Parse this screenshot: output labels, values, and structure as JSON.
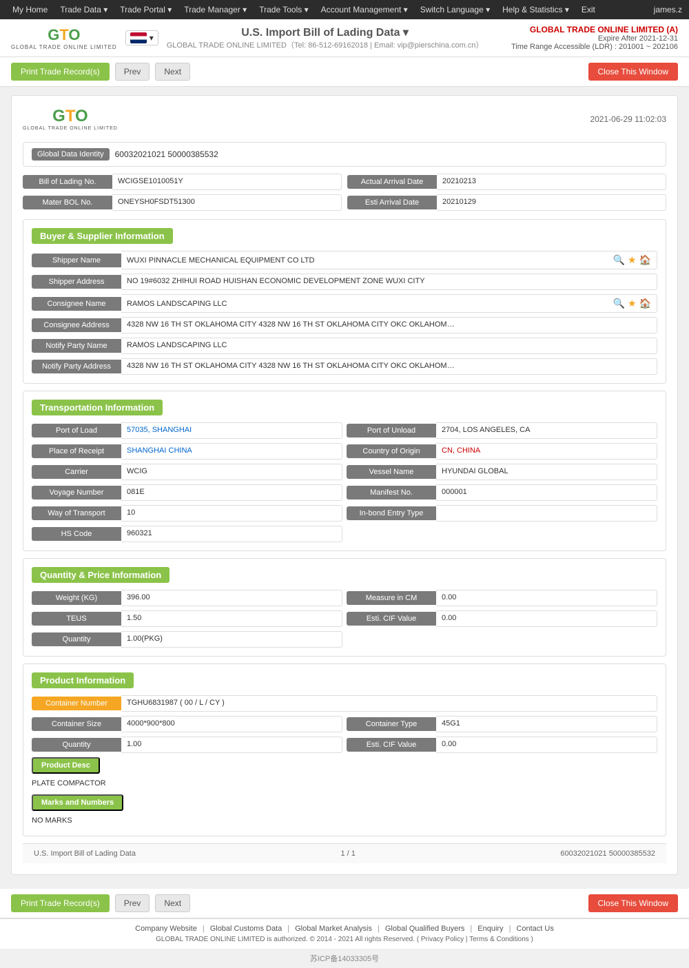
{
  "topnav": {
    "items": [
      "My Home",
      "Trade Data",
      "Trade Portal",
      "Trade Manager",
      "Trade Tools",
      "Account Management",
      "Switch Language",
      "Help & Statistics",
      "Exit"
    ],
    "user": "james.z"
  },
  "header": {
    "logo_g": "G",
    "logo_t": "T",
    "logo_o": "O",
    "logo_sub": "GLOBAL TRADE ONLINE LIMITED",
    "flag_alt": "US Flag",
    "title": "U.S. Import Bill of Lading Data",
    "title_arrow": "▾",
    "company": "GLOBAL TRADE ONLINE LIMITED（Tel: 86-512-69162018 | Email: vip@pierschina.com.cn）",
    "company_link": "GLOBAL TRADE ONLINE LIMITED (A)",
    "expire": "Expire After 2021-12-31",
    "range": "Time Range Accessible (LDR) : 201001 ~ 202106"
  },
  "toolbar": {
    "print_label": "Print Trade Record(s)",
    "prev_label": "Prev",
    "next_label": "Next",
    "close_label": "Close This Window"
  },
  "record": {
    "date": "2021-06-29 11:02:03",
    "global_data_identity": {
      "label": "Global Data Identity",
      "value": "60032021021 50000385532"
    },
    "bill_of_lading": {
      "label": "Bill of Lading No.",
      "value": "WCIGSE1010051Y",
      "actual_arrival_label": "Actual Arrival Date",
      "actual_arrival_value": "20210213"
    },
    "mater_bol": {
      "label": "Mater BOL No.",
      "value": "ONEYSH0FSDT51300",
      "esti_arrival_label": "Esti Arrival Date",
      "esti_arrival_value": "20210129"
    },
    "buyer_supplier": {
      "section_title": "Buyer & Supplier Information",
      "shipper_name_label": "Shipper Name",
      "shipper_name_value": "WUXI PINNACLE MECHANICAL EQUIPMENT CO LTD",
      "shipper_address_label": "Shipper Address",
      "shipper_address_value": "NO 19#6032 ZHIHUI ROAD HUISHAN ECONOMIC DEVELOPMENT ZONE WUXI CITY",
      "consignee_name_label": "Consignee Name",
      "consignee_name_value": "RAMOS LANDSCAPING LLC",
      "consignee_address_label": "Consignee Address",
      "consignee_address_value": "4328 NW 16 TH ST OKLAHOMA CITY 4328 NW 16 TH ST OKLAHOMA CITY OKC OKLAHOM…",
      "notify_party_name_label": "Notify Party Name",
      "notify_party_name_value": "RAMOS LANDSCAPING LLC",
      "notify_party_address_label": "Notify Party Address",
      "notify_party_address_value": "4328 NW 16 TH ST OKLAHOMA CITY 4328 NW 16 TH ST OKLAHOMA CITY OKC OKLAHOM…"
    },
    "transportation": {
      "section_title": "Transportation Information",
      "port_of_load_label": "Port of Load",
      "port_of_load_value": "57035, SHANGHAI",
      "port_of_unload_label": "Port of Unload",
      "port_of_unload_value": "2704, LOS ANGELES, CA",
      "place_of_receipt_label": "Place of Receipt",
      "place_of_receipt_value": "SHANGHAI CHINA",
      "country_of_origin_label": "Country of Origin",
      "country_of_origin_value": "CN, CHINA",
      "carrier_label": "Carrier",
      "carrier_value": "WCIG",
      "vessel_name_label": "Vessel Name",
      "vessel_name_value": "HYUNDAI GLOBAL",
      "voyage_number_label": "Voyage Number",
      "voyage_number_value": "081E",
      "manifest_no_label": "Manifest No.",
      "manifest_no_value": "000001",
      "way_of_transport_label": "Way of Transport",
      "way_of_transport_value": "10",
      "in_bond_entry_label": "In-bond Entry Type",
      "in_bond_entry_value": "",
      "hs_code_label": "HS Code",
      "hs_code_value": "960321"
    },
    "quantity_price": {
      "section_title": "Quantity & Price Information",
      "weight_label": "Weight (KG)",
      "weight_value": "396.00",
      "measure_label": "Measure in CM",
      "measure_value": "0.00",
      "teus_label": "TEUS",
      "teus_value": "1.50",
      "esti_cif_label": "Esti. CIF Value",
      "esti_cif_value": "0.00",
      "quantity_label": "Quantity",
      "quantity_value": "1.00(PKG)"
    },
    "product": {
      "section_title": "Product Information",
      "container_number_label": "Container Number",
      "container_number_value": "TGHU6831987 ( 00 / L / CY )",
      "container_size_label": "Container Size",
      "container_size_value": "4000*900*800",
      "container_type_label": "Container Type",
      "container_type_value": "45G1",
      "quantity_label": "Quantity",
      "quantity_value": "1.00",
      "esti_cif_label": "Esti. CIF Value",
      "esti_cif_value": "0.00",
      "product_desc_label": "Product Desc",
      "product_desc_value": "PLATE COMPACTOR",
      "marks_label": "Marks and Numbers",
      "marks_value": "NO MARKS"
    },
    "footer": {
      "left": "U.S. Import Bill of Lading Data",
      "page": "1 / 1",
      "id": "60032021021 50000385532"
    }
  },
  "bottom_toolbar": {
    "print_label": "Print Trade Record(s)",
    "prev_label": "Prev",
    "next_label": "Next",
    "close_label": "Close This Window"
  },
  "page_footer": {
    "icp": "苏ICP备14033305号",
    "links": [
      "Company Website",
      "Global Customs Data",
      "Global Market Analysis",
      "Global Qualified Buyers",
      "Enquiry",
      "Contact Us"
    ],
    "copyright": "GLOBAL TRADE ONLINE LIMITED is authorized. © 2014 - 2021 All rights Reserved.  ( Privacy Policy  |  Terms & Conditions )"
  }
}
